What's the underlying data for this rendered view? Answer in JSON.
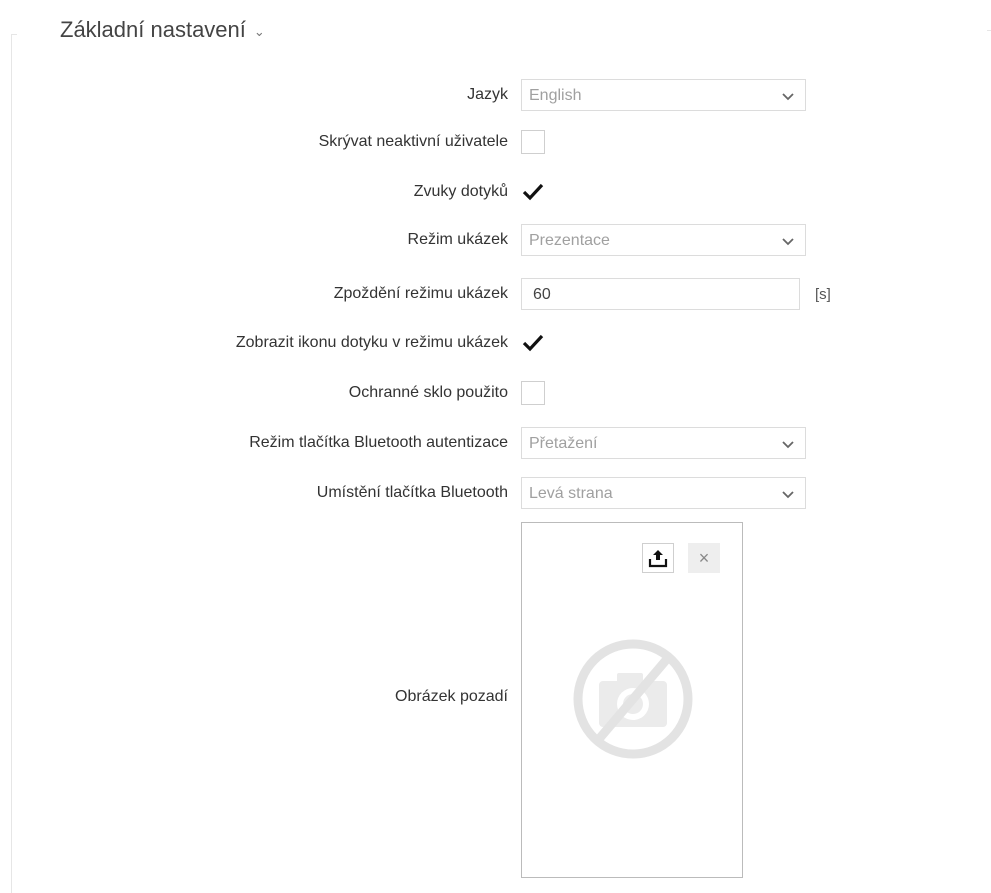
{
  "section": {
    "title": "Základní nastavení",
    "chevron": "chevron-down-icon"
  },
  "fields": {
    "language": {
      "label": "Jazyk",
      "value": "English"
    },
    "hide_inactive_users": {
      "label": "Skrývat neaktivní uživatele",
      "checked": false
    },
    "touch_sounds": {
      "label": "Zvuky dotyků",
      "checked": true
    },
    "demo_mode": {
      "label": "Režim ukázek",
      "value": "Prezentace"
    },
    "demo_delay": {
      "label": "Zpoždění režimu ukázek",
      "value": "60",
      "unit": "[s]"
    },
    "show_touch_icon": {
      "label": "Zobrazit ikonu dotyku v režimu ukázek",
      "checked": true
    },
    "protective_glass": {
      "label": "Ochranné sklo použito",
      "checked": false
    },
    "bt_auth_button_mode": {
      "label": "Režim tlačítka Bluetooth autentizace",
      "value": "Přetažení"
    },
    "bt_button_position": {
      "label": "Umístění tlačítka Bluetooth",
      "value": "Levá strana"
    },
    "background_image": {
      "label": "Obrázek pozadí",
      "upload_icon": "upload-icon",
      "remove_label": "×"
    }
  },
  "colors": {
    "text": "#333333",
    "border": "#dcdcdc",
    "placeholder": "#a0a0a0",
    "check": "#111111"
  }
}
